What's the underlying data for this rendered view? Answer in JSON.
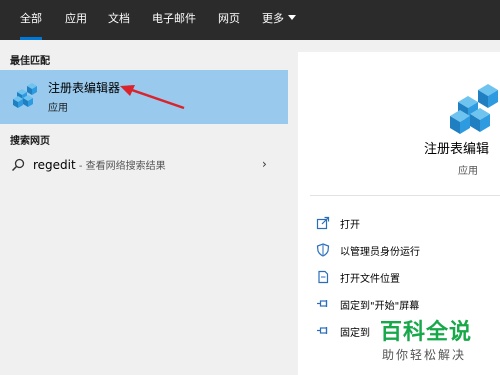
{
  "tabs": [
    {
      "label": "全部",
      "active": true
    },
    {
      "label": "应用"
    },
    {
      "label": "文档"
    },
    {
      "label": "电子邮件"
    },
    {
      "label": "网页"
    },
    {
      "label": "更多"
    }
  ],
  "left": {
    "best_match_label": "最佳匹配",
    "best": {
      "title": "注册表编辑器",
      "subtitle": "应用",
      "icon": "registry-editor-icon"
    },
    "web_label": "搜索网页",
    "web": {
      "query": "regedit",
      "suffix": " - 查看网络搜索结果",
      "icon": "search-icon"
    }
  },
  "right": {
    "title": "注册表编辑",
    "subtitle": "应用",
    "actions": [
      {
        "label": "打开",
        "icon": "open-icon"
      },
      {
        "label": "以管理员身份运行",
        "icon": "shield-icon"
      },
      {
        "label": "打开文件位置",
        "icon": "file-location-icon"
      },
      {
        "label": "固定到\"开始\"屏幕",
        "icon": "pin-icon"
      },
      {
        "label": "固定到",
        "icon": "pin-icon"
      }
    ]
  },
  "watermark": {
    "main": "百科全说",
    "sub": "助你轻松解决"
  },
  "colors": {
    "topbar": "#2b2b2b",
    "accent": "#0078d7",
    "highlight": "#99c9ec",
    "arrow": "#d9232d",
    "watermark": "#17a84a"
  }
}
